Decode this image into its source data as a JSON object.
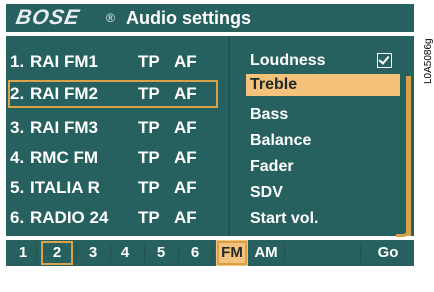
{
  "header": {
    "brand": "BOSE",
    "registered": "®",
    "title": "Audio settings"
  },
  "stations": [
    {
      "num": "1.",
      "name": "RAI FM1",
      "tp": "TP",
      "af": "AF",
      "selected": false
    },
    {
      "num": "2.",
      "name": "RAI FM2",
      "tp": "TP",
      "af": "AF",
      "selected": true
    },
    {
      "num": "3.",
      "name": "RAI FM3",
      "tp": "TP",
      "af": "AF",
      "selected": false
    },
    {
      "num": "4.",
      "name": "RMC FM",
      "tp": "TP",
      "af": "AF",
      "selected": false
    },
    {
      "num": "5.",
      "name": "ITALIA R",
      "tp": "TP",
      "af": "AF",
      "selected": false
    },
    {
      "num": "6.",
      "name": "RADIO 24",
      "tp": "TP",
      "af": "AF",
      "selected": false
    }
  ],
  "menu": {
    "items": [
      {
        "label": "Loudness",
        "checked": true
      },
      {
        "label": "Treble",
        "active": true
      },
      {
        "label": "Bass"
      },
      {
        "label": "Balance"
      },
      {
        "label": "Fader"
      },
      {
        "label": "SDV"
      },
      {
        "label": "Start vol."
      }
    ]
  },
  "bottombar": {
    "presets": [
      "1",
      "2",
      "3",
      "4",
      "5",
      "6"
    ],
    "selected_preset": "2",
    "band_fm": "FM",
    "band_am": "AM",
    "go_back": "Go back"
  },
  "side_code": "L0A5086g",
  "colors": {
    "panel": "#27615f",
    "highlight": "#f4c27a",
    "outline": "#d9a24a",
    "text": "#ffffff"
  }
}
